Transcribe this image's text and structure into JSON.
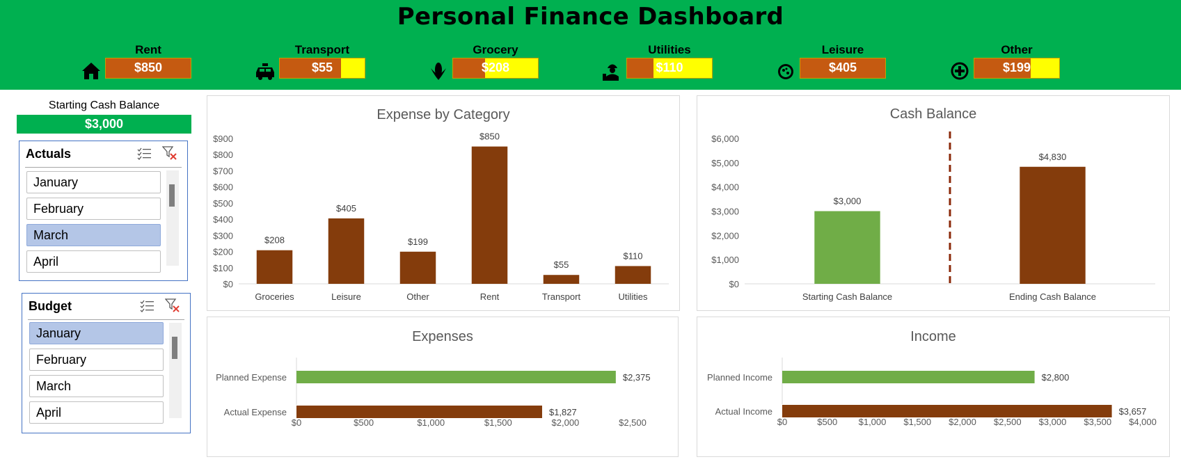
{
  "header": {
    "title": "Personal Finance Dashboard",
    "kpis": [
      {
        "label": "Rent",
        "value": "$850",
        "icon": "home-icon",
        "fill": 1.0
      },
      {
        "label": "Transport",
        "value": "$55",
        "icon": "taxi-icon",
        "fill": 0.72
      },
      {
        "label": "Grocery",
        "value": "$208",
        "icon": "corn-icon",
        "fill": 0.38
      },
      {
        "label": "Utilities",
        "value": "$110",
        "icon": "worker-icon",
        "fill": 0.31
      },
      {
        "label": "Leisure",
        "value": "$405",
        "icon": "pizza-icon",
        "fill": 1.0
      },
      {
        "label": "Other",
        "value": "$199",
        "icon": "plus-circle-icon",
        "fill": 0.66
      }
    ]
  },
  "sidebar": {
    "starting_cash_label": "Starting Cash Balance",
    "starting_cash_value": "$3,000",
    "actuals": {
      "title": "Actuals",
      "items": [
        {
          "label": "January",
          "selected": false
        },
        {
          "label": "February",
          "selected": false
        },
        {
          "label": "March",
          "selected": true
        },
        {
          "label": "April",
          "selected": false
        }
      ]
    },
    "budget": {
      "title": "Budget",
      "items": [
        {
          "label": "January",
          "selected": true
        },
        {
          "label": "February",
          "selected": false
        },
        {
          "label": "March",
          "selected": false
        },
        {
          "label": "April",
          "selected": false
        }
      ]
    }
  },
  "colors": {
    "header_green": "#00B050",
    "brown": "#843C0C",
    "orange": "#C55A11",
    "green": "#70AD47",
    "yellow": "#FFFF00",
    "selected": "#B4C6E7"
  },
  "chart_data": [
    {
      "type": "bar",
      "title": "Expense by Category",
      "categories": [
        "Groceries",
        "Leisure",
        "Other",
        "Rent",
        "Transport",
        "Utilities"
      ],
      "values": [
        208,
        405,
        199,
        850,
        55,
        110
      ],
      "data_labels": [
        "$208",
        "$405",
        "$199",
        "$850",
        "$55",
        "$110"
      ],
      "yticks": [
        "$0",
        "$100",
        "$200",
        "$300",
        "$400",
        "$500",
        "$600",
        "$700",
        "$800",
        "$900"
      ],
      "ylim": [
        0,
        900
      ],
      "grid": false
    },
    {
      "type": "bar",
      "title": "Cash Balance",
      "categories": [
        "Starting Cash Balance",
        "Ending Cash Balance"
      ],
      "values": [
        3000,
        4830
      ],
      "data_labels": [
        "$3,000",
        "$4,830"
      ],
      "yticks": [
        "$0",
        "$1,000",
        "$2,000",
        "$3,000",
        "$4,000",
        "$5,000",
        "$6,000"
      ],
      "ylim": [
        0,
        6000
      ],
      "grid": false
    },
    {
      "type": "bar",
      "orientation": "horizontal",
      "title": "Expenses",
      "categories": [
        "Planned Expense",
        "Actual Expense"
      ],
      "values": [
        2375,
        1827
      ],
      "data_labels": [
        "$2,375",
        "$1,827"
      ],
      "xticks": [
        "$0",
        "$500",
        "$1,000",
        "$1,500",
        "$2,000",
        "$2,500"
      ],
      "xlim": [
        0,
        2500
      ],
      "grid": false
    },
    {
      "type": "bar",
      "orientation": "horizontal",
      "title": "Income",
      "categories": [
        "Planned Income",
        "Actual Income"
      ],
      "values": [
        2800,
        3657
      ],
      "data_labels": [
        "$2,800",
        "$3,657"
      ],
      "xticks": [
        "$0",
        "$500",
        "$1,000",
        "$1,500",
        "$2,000",
        "$2,500",
        "$3,000",
        "$3,500",
        "$4,000"
      ],
      "xlim": [
        0,
        4000
      ],
      "grid": false
    }
  ]
}
